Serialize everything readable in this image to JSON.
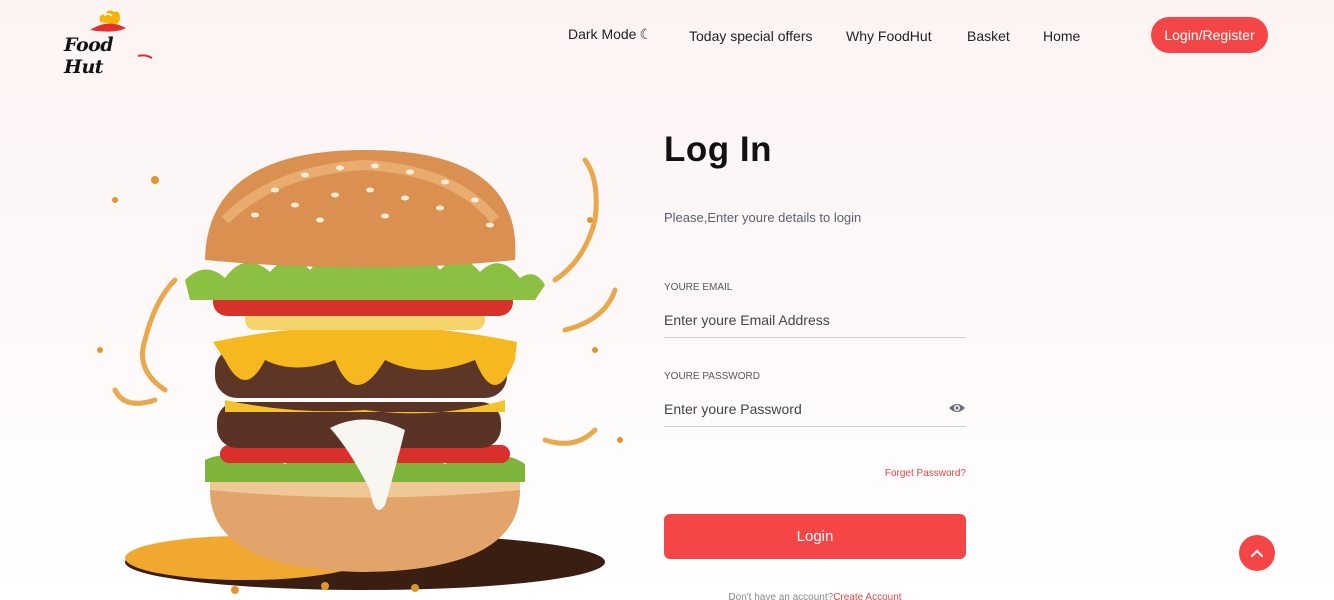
{
  "brand": {
    "logo_text": "Food Hut"
  },
  "nav": {
    "items": [
      {
        "label": "Dark Mode",
        "icon": "moon-icon"
      },
      {
        "label": "Today special offers"
      },
      {
        "label": "Why FoodHut"
      },
      {
        "label": "Basket"
      },
      {
        "label": "Home"
      }
    ],
    "login_register": "Login/Register"
  },
  "form": {
    "title": "Log In",
    "subtitle": "Please,Enter youre details to login",
    "email_label": "YOURE EMAIL",
    "email_placeholder": "Enter youre Email Address",
    "password_label": "YOURE PASSWORD",
    "password_placeholder": "Enter youre Password",
    "forgot": "Forget Password?",
    "submit": "Login",
    "signup_prompt": "Don't have an account?",
    "signup_link": "Create Account"
  },
  "colors": {
    "accent": "#f44646",
    "background": "#fdf3f3"
  },
  "icons": {
    "password_toggle": "eye-icon",
    "scroll_top": "chevron-up-icon"
  }
}
